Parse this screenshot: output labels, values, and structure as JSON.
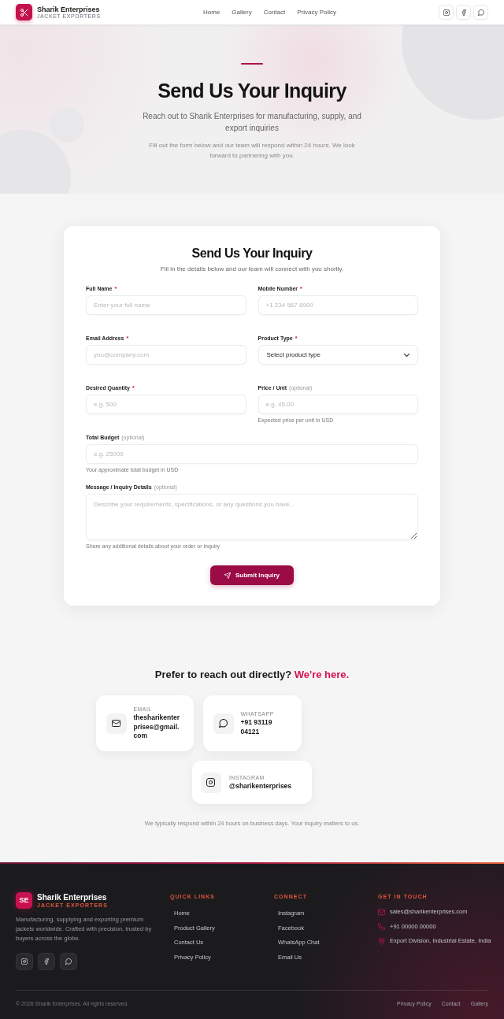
{
  "header": {
    "brand": {
      "name": "Sharik Enterprises",
      "tagline": "JACKET EXPORTERS"
    },
    "nav": [
      {
        "label": "Home"
      },
      {
        "label": "Gallery"
      },
      {
        "label": "Contact"
      },
      {
        "label": "Privacy Policy"
      }
    ]
  },
  "hero": {
    "title": "Send Us Your Inquiry",
    "subtitle": "Reach out to Sharik Enterprises for manufacturing, supply, and export inquiries",
    "description": "Fill out the form below and our team will respond within 24 hours. We look forward to partnering with you."
  },
  "form": {
    "title": "Send Us Your Inquiry",
    "subtitle": "Fill in the details below and our team will connect with you shortly.",
    "rows": [
      [
        {
          "kind": "input",
          "label": "Full Name",
          "mark": "*",
          "placeholder": "Enter your full name"
        },
        {
          "kind": "input",
          "label": "Mobile Number",
          "mark": "*",
          "placeholder": "+1 234 567 8900"
        }
      ],
      [
        {
          "kind": "input",
          "label": "Email Address",
          "mark": "*",
          "placeholder": "you@company.com"
        },
        {
          "kind": "select",
          "label": "Product Type",
          "mark": "*",
          "value": "Select product type"
        }
      ],
      [
        {
          "kind": "input",
          "label": "Desired Quantity",
          "mark": "*",
          "placeholder": "e.g. 500"
        },
        {
          "kind": "input",
          "label": "Price / Unit",
          "note": "(optional)",
          "placeholder": "e.g. 45.00",
          "help": "Expected price per unit in USD"
        }
      ],
      [
        {
          "kind": "input",
          "label": "Total Budget",
          "note": "(optional)",
          "placeholder": "e.g. 25000",
          "help": "Your approximate total budget in USD"
        }
      ],
      [
        {
          "kind": "textarea",
          "label": "Message / Inquiry Details",
          "note": "(optional)",
          "placeholder": "Describe your requirements, specifications, or any questions you have...",
          "help": "Share any additional details about your order or inquiry"
        }
      ]
    ],
    "submit": "Submit Inquiry"
  },
  "contact": {
    "heading": "Prefer to reach out directly?",
    "accent": "We're here.",
    "cards": [
      {
        "kind": "email",
        "label": "EMAIL",
        "value": "thesharikenterprises@gmail.com"
      },
      {
        "kind": "whatsapp",
        "label": "WHATSAPP",
        "value": "+91 93119 04121"
      },
      {
        "kind": "instagram",
        "label": "INSTAGRAM",
        "value": "@sharikenterprises"
      }
    ],
    "note": "We typically respond within 24 hours on business days. Your inquiry matters to us."
  },
  "footer": {
    "brand": {
      "initials": "SE",
      "name": "Sharik Enterprises",
      "tagline": "JACKET EXPORTERS"
    },
    "description": "Manufacturing, supplying and exporting premium jackets worldwide. Crafted with precision, trusted by buyers across the globe.",
    "columns": [
      {
        "title": "QUICK LINKS",
        "links": [
          "Home",
          "Product Gallery",
          "Contact Us",
          "Privacy Policy"
        ]
      },
      {
        "title": "CONNECT",
        "links": [
          "Instagram",
          "Facebook",
          "WhatsApp Chat",
          "Email Us"
        ]
      }
    ],
    "get_in_touch": {
      "title": "GET IN TOUCH",
      "items": [
        {
          "kind": "email",
          "text": "sales@sharikenterprises.com"
        },
        {
          "kind": "phone",
          "text": "+91 00000 00000"
        },
        {
          "kind": "location",
          "text": "Export Division, Industrial Estate, India"
        }
      ]
    },
    "copyright": "© 2026 Sharik Enterprises. All rights reserved.",
    "bottom_links": [
      "Privacy Policy",
      "Contact",
      "Gallery"
    ]
  }
}
